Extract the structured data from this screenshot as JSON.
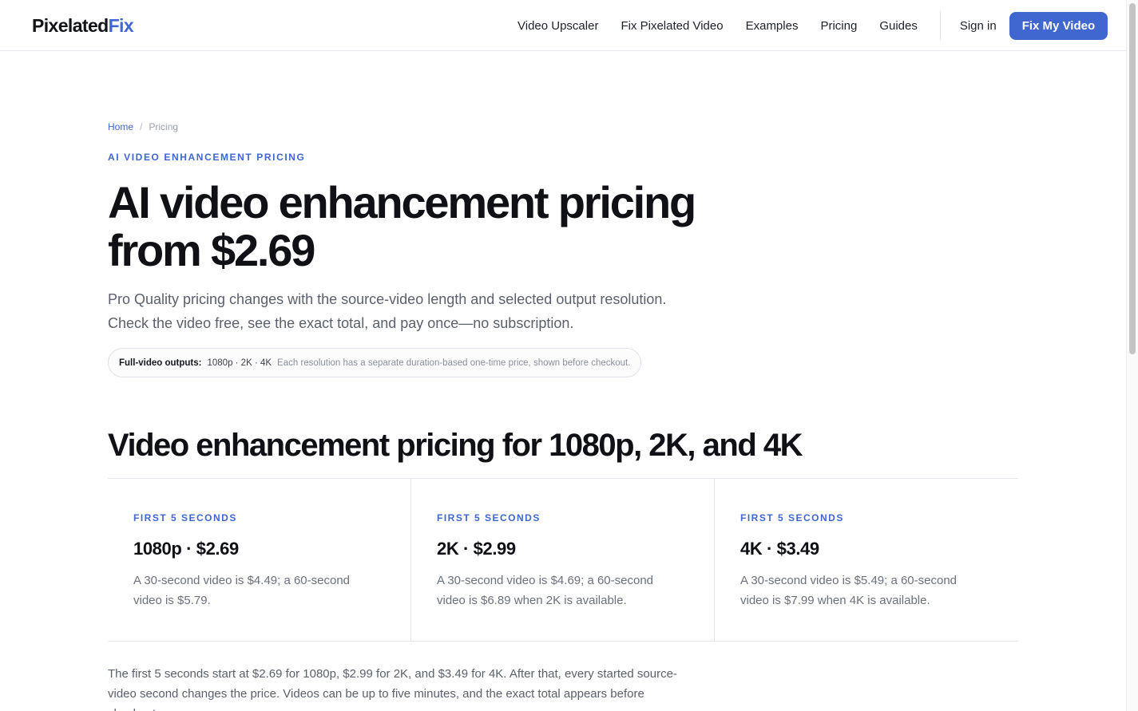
{
  "header": {
    "logo_main": "Pixelated",
    "logo_accent": "Fix",
    "nav": [
      {
        "label": "Video Upscaler"
      },
      {
        "label": "Fix Pixelated Video"
      },
      {
        "label": "Examples"
      },
      {
        "label": "Pricing"
      },
      {
        "label": "Guides"
      }
    ],
    "sign_in": "Sign in",
    "cta": "Fix My Video"
  },
  "breadcrumb": {
    "home": "Home",
    "separator": "/",
    "current": "Pricing"
  },
  "hero": {
    "eyebrow": "AI video enhancement pricing",
    "title": "AI video enhancement pricing from $2.69",
    "subtitle": "Pro Quality pricing changes with the source-video length and selected output resolution. Check the video free, see the exact total, and pay once—no subscription.",
    "pill": {
      "label": "Full-video outputs:",
      "resolutions": "1080p · 2K · 4K",
      "note": "Each resolution has a separate duration-based one-time price, shown before checkout."
    }
  },
  "pricing": {
    "section_title": "Video enhancement pricing for 1080p, 2K, and 4K",
    "cards": [
      {
        "kicker": "First 5 seconds",
        "price": "1080p · $2.69",
        "description": "A 30-second video is $4.49; a 60-second video is $5.79."
      },
      {
        "kicker": "First 5 seconds",
        "price": "2K · $2.99",
        "description": "A 30-second video is $4.69; a 60-second video is $6.89 when 2K is available."
      },
      {
        "kicker": "First 5 seconds",
        "price": "4K · $3.49",
        "description": "A 30-second video is $5.49; a 60-second video is $7.99 when 4K is available."
      }
    ],
    "body": "The first 5 seconds start at $2.69 for 1080p, $2.99 for 2K, and $3.49 for 4K. After that, every started source-video second changes the price. Videos can be up to five minutes, and the exact total appears before checkout."
  },
  "colors": {
    "accent": "#3f67cf",
    "text": "#0f1116",
    "muted": "#5a606c"
  }
}
